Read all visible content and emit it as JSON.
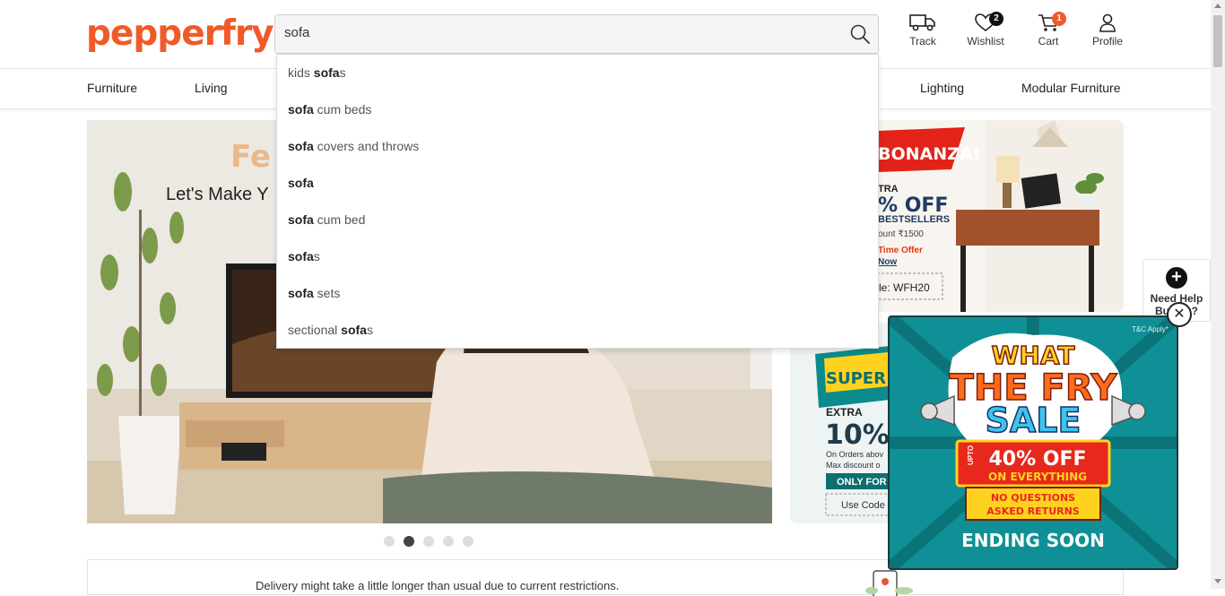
{
  "brand": {
    "logo_text": "pepperfry",
    "accent": "#f05a28"
  },
  "search": {
    "value": "sofa",
    "placeholder": ""
  },
  "header_actions": [
    {
      "label": "Track",
      "icon": "truck-icon"
    },
    {
      "label": "Wishlist",
      "icon": "heart-icon",
      "badge": "2"
    },
    {
      "label": "Cart",
      "icon": "cart-icon",
      "badge": "1"
    },
    {
      "label": "Profile",
      "icon": "user-icon"
    }
  ],
  "nav": {
    "items": [
      "Furniture",
      "Living",
      "Lighting",
      "Modular Furniture"
    ]
  },
  "suggestions": [
    {
      "pre": "kids ",
      "bold": "sofa",
      "post": "s"
    },
    {
      "pre": "",
      "bold": "sofa",
      "post": " cum beds"
    },
    {
      "pre": "",
      "bold": "sofa",
      "post": " covers and throws"
    },
    {
      "pre": "",
      "bold": "sofa",
      "post": ""
    },
    {
      "pre": "",
      "bold": "sofa",
      "post": " cum bed"
    },
    {
      "pre": "",
      "bold": "sofa",
      "post": "s"
    },
    {
      "pre": "",
      "bold": "sofa",
      "post": " sets"
    },
    {
      "pre": "sectional ",
      "bold": "sofa",
      "post": "s"
    }
  ],
  "banner": {
    "heading_partial": "Fe",
    "subheading_partial": "Let's Make Y"
  },
  "right_card1": {
    "ribbon": "BONANZA!",
    "line1": "TRA",
    "line2": "% OFF",
    "line3": "BESTSELLERS",
    "line4": "ount ₹1500",
    "line5": "Time Offer",
    "line6": "Now",
    "code": "le: WFH20"
  },
  "right_card2": {
    "ribbon": "SUPER S",
    "line1": "EXTRA",
    "line2": "10%",
    "line3": "On Orders abov",
    "line4": "Max discount o",
    "line5": "ONLY FOR",
    "code": "Use Code"
  },
  "carousel": {
    "count": 5,
    "active": 1
  },
  "delivery": {
    "text": "Delivery might take a little longer than usual due to current restrictions."
  },
  "help": {
    "label_line1": "Need Help",
    "label_line2": "Buying?"
  },
  "popup": {
    "tc": "T&C Apply*",
    "title1": "WHAT",
    "title2": "THE FRY",
    "title3": "SALE",
    "upto": "UPTO",
    "offer": "40% OFF",
    "offer_sub": "ON EVERYTHING",
    "noq1": "NO QUESTIONS",
    "noq2": "ASKED RETURNS",
    "ending": "ENDING SOON"
  },
  "colors": {
    "orange": "#f05a28",
    "popup_bg": "#0e8e93",
    "yellow": "#ffd21f",
    "red": "#e8281c"
  }
}
